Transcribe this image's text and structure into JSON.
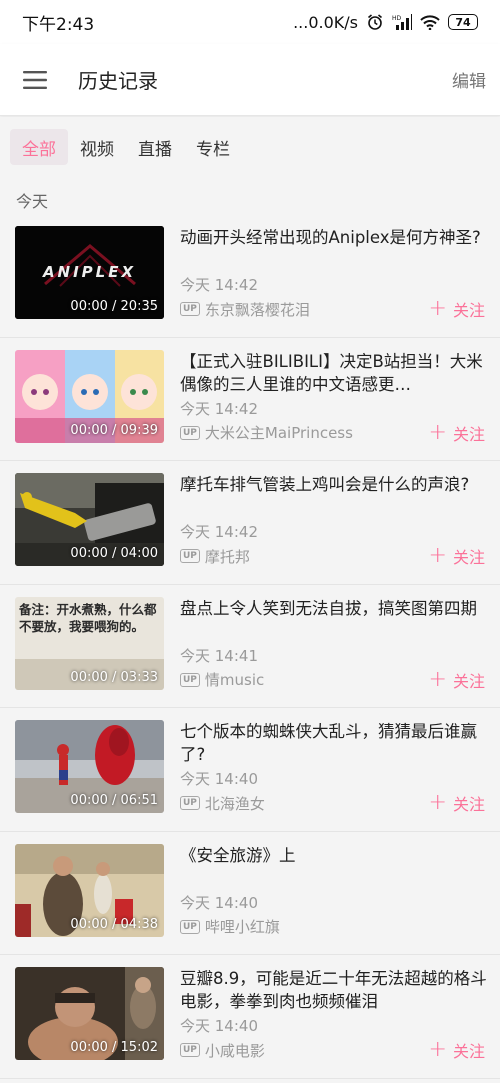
{
  "status_bar": {
    "time": "下午2:43",
    "network_speed": "...0.0K/s",
    "alarm_icon": "alarm-icon",
    "signal_icon": "signal-icon",
    "wifi_icon": "wifi-icon",
    "battery": "74"
  },
  "app_bar": {
    "title": "历史记录",
    "edit_label": "编辑",
    "menu_icon": "hamburger-menu-icon"
  },
  "tabs": [
    {
      "label": "全部",
      "active": true
    },
    {
      "label": "视频",
      "active": false
    },
    {
      "label": "直播",
      "active": false
    },
    {
      "label": "专栏",
      "active": false
    }
  ],
  "section": {
    "label": "今天"
  },
  "accent_color": "#fb7299",
  "items": [
    {
      "title": "动画开头经常出现的Aniplex是何方神圣?",
      "duration": "00:00 / 20:35",
      "time": "今天 14:42",
      "uploader": "东京飘落樱花泪",
      "follow": "关注",
      "up_badge": "UP"
    },
    {
      "title": "【正式入驻BILIBILI】决定B站担当！大米偶像的三人里谁的中文语感更…",
      "duration": "00:00 / 09:39",
      "time": "今天 14:42",
      "uploader": "大米公主MaiPrincess",
      "follow": "关注",
      "up_badge": "UP"
    },
    {
      "title": "摩托车排气管装上鸡叫会是什么的声浪?",
      "duration": "00:00 / 04:00",
      "time": "今天 14:42",
      "uploader": "摩托邦",
      "follow": "关注",
      "up_badge": "UP"
    },
    {
      "title": "盘点上令人笑到无法自拔，搞笑图第四期",
      "duration": "00:00 / 03:33",
      "time": "今天 14:41",
      "uploader": "情music",
      "follow": "关注",
      "up_badge": "UP"
    },
    {
      "title": "七个版本的蜘蛛侠大乱斗，猜猜最后谁赢了?",
      "duration": "00:00 / 06:51",
      "time": "今天 14:40",
      "uploader": "北海渔女",
      "follow": "关注",
      "up_badge": "UP"
    },
    {
      "title": "《安全旅游》上",
      "duration": "00:00 / 04:38",
      "time": "今天 14:40",
      "uploader": "哔哩小红旗",
      "follow": "",
      "up_badge": "UP"
    },
    {
      "title": "豆瓣8.9，可能是近二十年无法超越的格斗电影，拳拳到肉也频频催泪",
      "duration": "00:00 / 15:02",
      "time": "今天 14:40",
      "uploader": "小咸电影",
      "follow": "关注",
      "up_badge": "UP"
    }
  ],
  "thumbnail_texts": {
    "aniplex_logo": "ANIPLEX",
    "note_text": "备注：开水煮熟，什么都不要放，我要喂狗的。"
  }
}
